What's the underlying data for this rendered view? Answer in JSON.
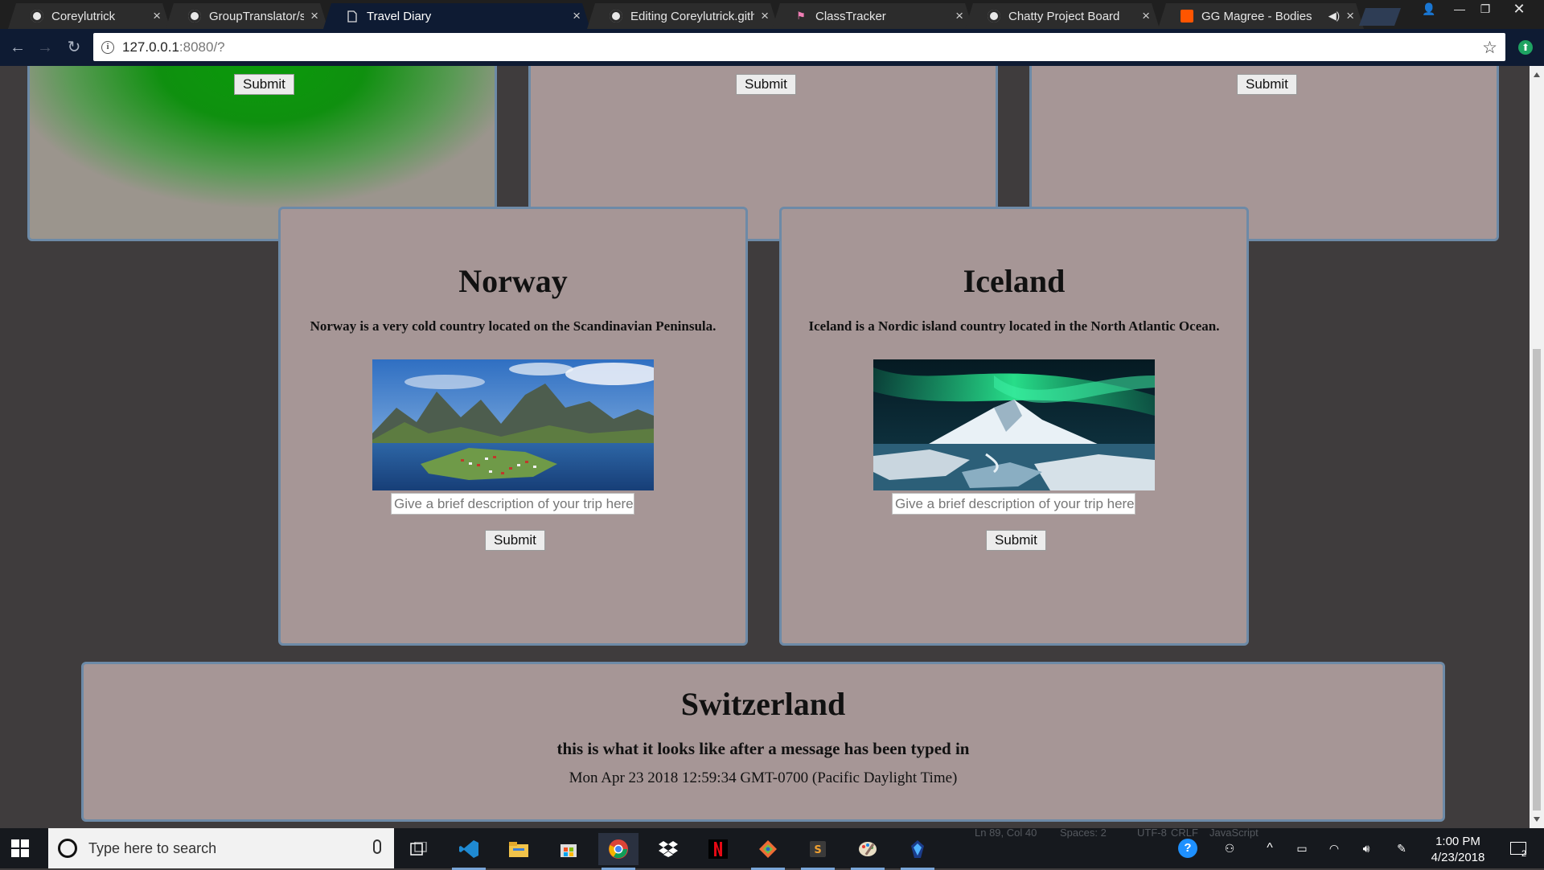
{
  "tabs": [
    {
      "label": "Coreylutrick",
      "icon": "github-icon",
      "active": false
    },
    {
      "label": "GroupTranslator/screens",
      "icon": "github-icon",
      "active": false
    },
    {
      "label": "Travel Diary",
      "icon": "document-icon",
      "active": true
    },
    {
      "label": "Editing Coreylutrick.githu",
      "icon": "github-icon",
      "active": false
    },
    {
      "label": "ClassTracker",
      "icon": "flamingo-icon",
      "active": false
    },
    {
      "label": "Chatty Project Board",
      "icon": "github-icon",
      "active": false
    },
    {
      "label": "GG Magree - Bodies",
      "icon": "soundcloud-icon",
      "active": false
    }
  ],
  "address": {
    "host": "127.0.0.1",
    "rest": ":8080/?"
  },
  "page": {
    "top_cards": [
      {
        "submit_label": "Submit",
        "style": "green"
      },
      {
        "submit_label": "Submit",
        "style": "plain"
      },
      {
        "submit_label": "Submit",
        "style": "plain"
      }
    ],
    "norway": {
      "title": "Norway",
      "description": "Norway is a very cold country located on the Scandinavian Peninsula.",
      "input_placeholder": "Give a brief description of your trip here!",
      "submit_label": "Submit"
    },
    "iceland": {
      "title": "Iceland",
      "description": "Iceland is a Nordic island country located in the North Atlantic Ocean.",
      "input_placeholder": "Give a brief description of your trip here!",
      "submit_label": "Submit"
    },
    "switzerland": {
      "title": "Switzerland",
      "entry": "this is what it looks like after a message has been typed in",
      "timestamp": "Mon Apr 23 2018 12:59:34 GMT-0700 (Pacific Daylight Time)"
    }
  },
  "editor_status_ghost": {
    "position": "Ln 89, Col 40",
    "spaces": "Spaces: 2",
    "encoding": "UTF-8",
    "eol": "CRLF",
    "language": "JavaScript"
  },
  "taskbar": {
    "search_placeholder": "Type here to search",
    "clock_time": "1:00 PM",
    "clock_date": "4/23/2018",
    "notification_count": "2",
    "apps": [
      "task-view",
      "vscode",
      "file-explorer",
      "store",
      "chrome",
      "dropbox",
      "netflix",
      "git",
      "sublime",
      "paint",
      "compass"
    ]
  },
  "colors": {
    "page_bg": "#3f3c3d",
    "card_bg": "#a69696",
    "card_border": "#6d8aa7",
    "active_tab": "#0e1b33",
    "green_card": "#0a9a0a"
  }
}
